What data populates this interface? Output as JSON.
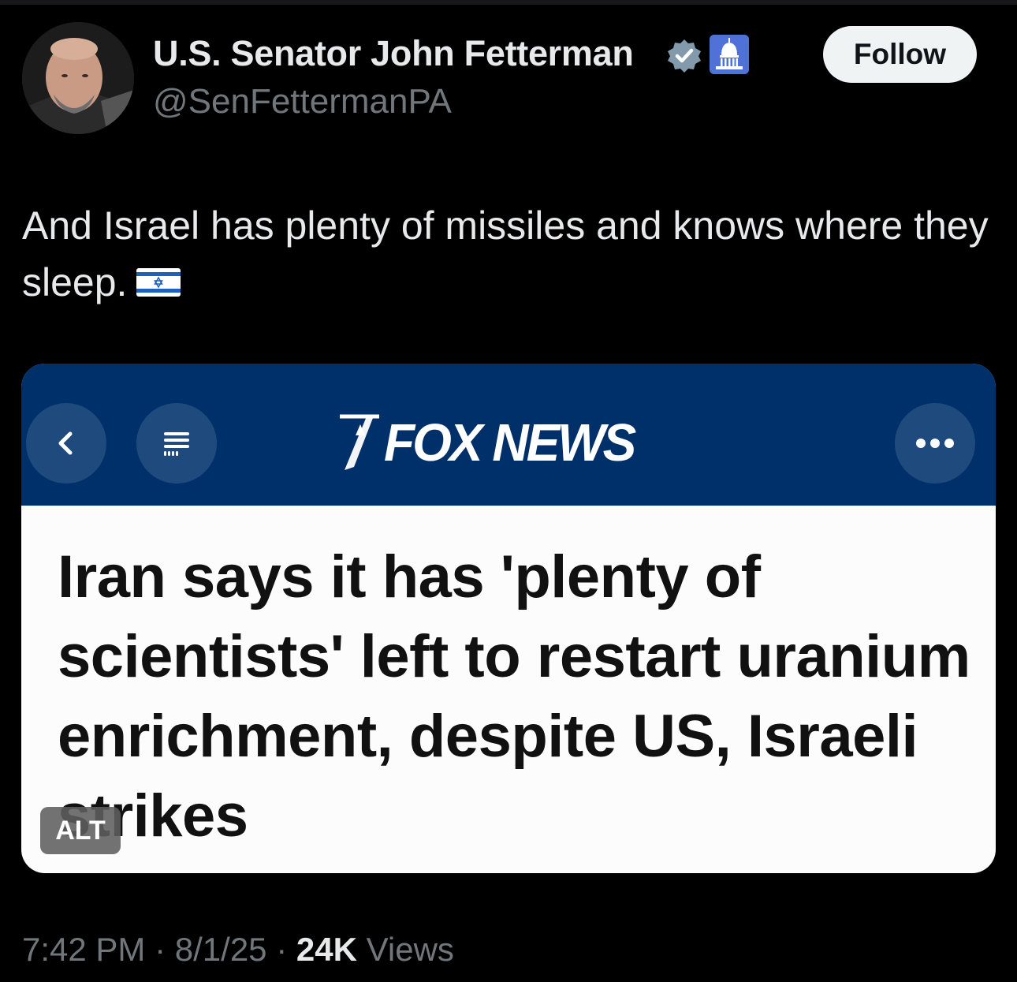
{
  "author": {
    "name": "U.S. Senator John Fetterman",
    "handle": "@SenFettermanPA",
    "verified_icon": "verified-badge-icon",
    "affiliation_icon": "us-capitol-icon"
  },
  "actions": {
    "follow_label": "Follow"
  },
  "tweet": {
    "text": "And Israel has plenty of missiles and knows where they sleep.",
    "emoji": "israel-flag-icon"
  },
  "media": {
    "logo_text": "FOX NEWS",
    "headline": "Iran says it has 'plenty of scientists' left to restart uranium enrichment, despite US, Israeli strikes",
    "alt_label": "ALT",
    "header_color": "#00306a"
  },
  "meta": {
    "time": "7:42 PM",
    "separator": "·",
    "date": "8/1/25",
    "views_count": "24K",
    "views_label": "Views"
  },
  "colors": {
    "background": "#000000",
    "text_primary": "#e7e9ea",
    "text_secondary": "#71767b",
    "verified": "#829aab"
  }
}
